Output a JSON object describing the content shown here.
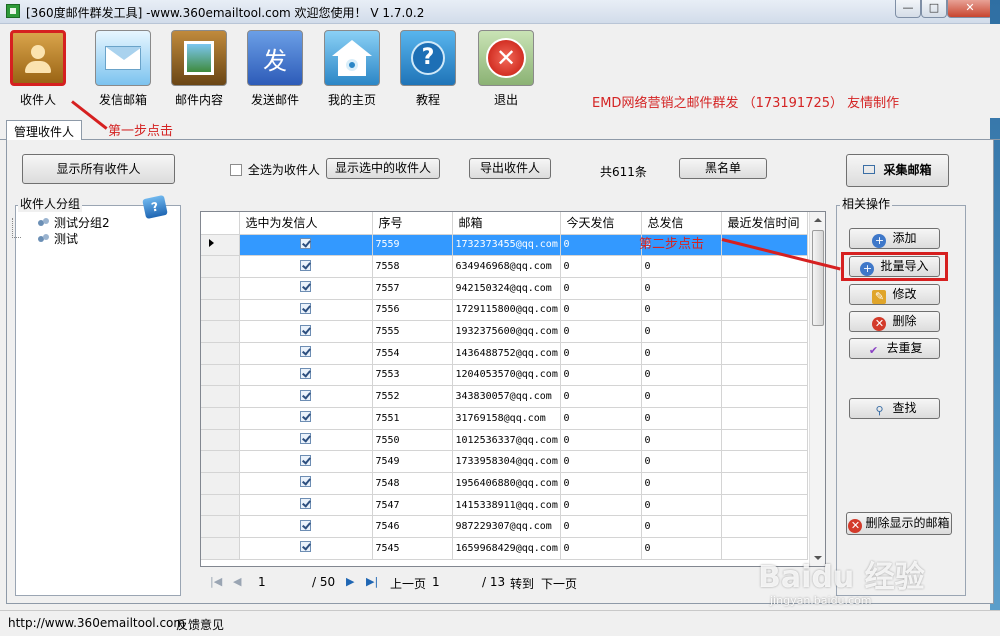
{
  "window": {
    "title": "[360度邮件群发工具] -www.360emailtool.com   欢迎您使用！   V 1.7.0.2",
    "min_glyph": "—",
    "max_glyph": "□",
    "close_glyph": "✕"
  },
  "toolbar": {
    "items": [
      {
        "label": "收件人",
        "icon": "recipient-book-icon"
      },
      {
        "label": "发信邮箱",
        "icon": "envelope-icon"
      },
      {
        "label": "邮件内容",
        "icon": "picture-frame-icon"
      },
      {
        "label": "发送邮件",
        "icon": "send-char-icon",
        "glyph": "发"
      },
      {
        "label": "我的主页",
        "icon": "home-icon"
      },
      {
        "label": "教程",
        "icon": "help-icon",
        "glyph": "?"
      },
      {
        "label": "退出",
        "icon": "exit-icon",
        "glyph": "✕"
      }
    ],
    "credit": "EMD网络营销之邮件群发 （173191725） 友情制作"
  },
  "annotations": {
    "step1": "第一步点击",
    "step2": "第二步点击"
  },
  "tab": {
    "label": "管理收件人"
  },
  "controls": {
    "show_all": "显示所有收件人",
    "select_all": "全选为收件人",
    "show_selected": "显示选中的收件人",
    "export": "导出收件人",
    "total": "共611条",
    "blacklist": "黑名单",
    "collect": "采集邮箱"
  },
  "groups": {
    "label": "收件人分组",
    "help_glyph": "?",
    "items": [
      "测试分组2",
      "测试"
    ]
  },
  "grid": {
    "columns": [
      "选中为发信人",
      "序号",
      "邮箱",
      "今天发信",
      "总发信",
      "最近发信时间"
    ],
    "rows": [
      {
        "id": "7559",
        "email": "1732373455@qq.com",
        "today": "0",
        "total": "0",
        "last": ""
      },
      {
        "id": "7558",
        "email": "634946968@qq.com",
        "today": "0",
        "total": "0",
        "last": ""
      },
      {
        "id": "7557",
        "email": "942150324@qq.com",
        "today": "0",
        "total": "0",
        "last": ""
      },
      {
        "id": "7556",
        "email": "1729115800@qq.com",
        "today": "0",
        "total": "0",
        "last": ""
      },
      {
        "id": "7555",
        "email": "1932375600@qq.com",
        "today": "0",
        "total": "0",
        "last": ""
      },
      {
        "id": "7554",
        "email": "1436488752@qq.com",
        "today": "0",
        "total": "0",
        "last": ""
      },
      {
        "id": "7553",
        "email": "1204053570@qq.com",
        "today": "0",
        "total": "0",
        "last": ""
      },
      {
        "id": "7552",
        "email": "343830057@qq.com",
        "today": "0",
        "total": "0",
        "last": ""
      },
      {
        "id": "7551",
        "email": "31769158@qq.com",
        "today": "0",
        "total": "0",
        "last": ""
      },
      {
        "id": "7550",
        "email": "1012536337@qq.com",
        "today": "0",
        "total": "0",
        "last": ""
      },
      {
        "id": "7549",
        "email": "1733958304@qq.com",
        "today": "0",
        "total": "0",
        "last": ""
      },
      {
        "id": "7548",
        "email": "1956406880@qq.com",
        "today": "0",
        "total": "0",
        "last": ""
      },
      {
        "id": "7547",
        "email": "1415338911@qq.com",
        "today": "0",
        "total": "0",
        "last": ""
      },
      {
        "id": "7546",
        "email": "987229307@qq.com",
        "today": "0",
        "total": "0",
        "last": ""
      },
      {
        "id": "7545",
        "email": "1659968429@qq.com",
        "today": "0",
        "total": "0",
        "last": ""
      }
    ]
  },
  "pager": {
    "page": "1",
    "pages": "/ 50",
    "prev_label": "上一页",
    "goto_value": "1",
    "goto_total": "/ 13",
    "goto_label": "转到",
    "next_label": "下一页"
  },
  "ops": {
    "label": "相关操作",
    "add": "添加",
    "import": "批量导入",
    "edit": "修改",
    "delete": "删除",
    "dedupe": "去重复",
    "find": "查找",
    "delete_shown": "删除显示的邮箱"
  },
  "status": {
    "url": "http://www.360emailtool.com",
    "feedback": "反馈意见"
  },
  "watermark": {
    "brand": "Baidu 经验",
    "url": "jingyan.baidu.com"
  },
  "colors": {
    "annotation": "#d62020",
    "selected_row": "#3399ff"
  }
}
